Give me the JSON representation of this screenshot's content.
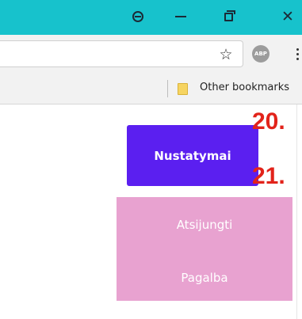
{
  "window_controls": {
    "profile_icon": "profile-icon",
    "minimize_icon": "minimize-icon",
    "restore_icon": "restore-icon",
    "close_icon": "close-icon",
    "close_glyph": "✕"
  },
  "toolbar": {
    "bookmark_star_icon": "star-icon",
    "star_glyph": "☆",
    "adblock_icon": "adblock-icon",
    "adblock_label": "ABP",
    "menu_icon": "more-vert-icon"
  },
  "bookmarks_bar": {
    "other_bookmarks_label": "Other bookmarks"
  },
  "page": {
    "settings_button_label": "Nustatymai",
    "menu_items": [
      {
        "label": "Atsijungti"
      },
      {
        "label": "Pagalba"
      }
    ]
  },
  "annotations": [
    "20.",
    "21."
  ],
  "colors": {
    "titlebar": "#17c2cc",
    "settings_button": "#5b1ff0",
    "dropdown_menu": "#e8a2d0",
    "annotation": "#e2231a"
  }
}
